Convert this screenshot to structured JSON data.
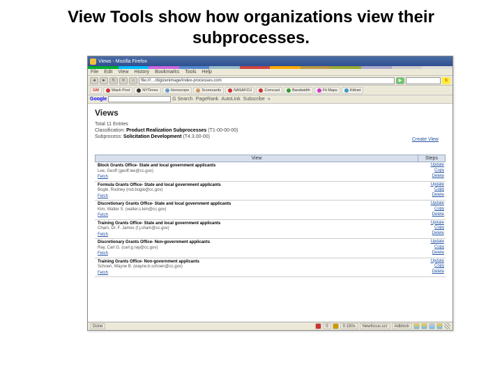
{
  "slide_title": "View Tools show how organizations view their subprocesses.",
  "window_title": "Views - Mozilla Firefox",
  "menu": [
    "File",
    "Edit",
    "View",
    "History",
    "Bookmarks",
    "Tools",
    "Help"
  ],
  "nav": {
    "address": "file:///…/digizenimage/index-processes.com"
  },
  "bookmarks": [
    {
      "label": "Wash Post",
      "color": "#c33"
    },
    {
      "label": "NYTimes",
      "color": "#333"
    },
    {
      "label": "Horoscope",
      "color": "#69c"
    },
    {
      "label": "Scorecards",
      "color": "#c96"
    },
    {
      "label": "NASAFCU",
      "color": "#c33"
    },
    {
      "label": "Comcast",
      "color": "#c33"
    },
    {
      "label": "Bandwidth",
      "color": "#393"
    },
    {
      "label": "Fit Maps",
      "color": "#c3c"
    },
    {
      "label": "Kittnet",
      "color": "#39c"
    }
  ],
  "google_bar": {
    "logo": "Google",
    "items": [
      "G Search",
      "PageRank",
      "AutoLink",
      "Subscribe",
      "»"
    ]
  },
  "views": {
    "heading": "Views",
    "total": "Total 11 Entries",
    "classification_label": "Classification:",
    "classification_value": "Product Realization Subprocesses",
    "classification_code": "(T1-00-00-00)",
    "subprocess_label": "Subprocess:",
    "subprocess_value": "Solicitation Development",
    "subprocess_code": "(T4.3.00-00)",
    "create": "Create View",
    "col_view": "View",
    "col_steps": "Steps",
    "rows": [
      {
        "title": "Block Grants Office- State and local government applicants",
        "sub": "Lee, Geoff (geoff.lee@cc.gov)"
      },
      {
        "title": "Formula Grants Office- State and local government applicants",
        "sub": "Bogle, Rodney (rod.bogle@cc.gov)"
      },
      {
        "title": "Discretionary Grants Office- State and local government applicants",
        "sub": "Kim, Walter S. (walter.s.kim@cc.gov)"
      },
      {
        "title": "Training Grants Office- State and local government applicants",
        "sub": "Cham, Dr. F. James (f.j.cham@cc.gov)"
      },
      {
        "title": "Discretionary Grants Office- Non-government applicants",
        "sub": "Ray, Carl G. (carl.g.ray@cc.gov)"
      },
      {
        "title": "Training Grants Office- Non-government applicants",
        "sub": "Schoen, Wayne B. (wayne.b.schoen@cc.gov)"
      }
    ],
    "fetch": "Fetch",
    "actions": [
      "Update",
      "Copy",
      "Delete"
    ]
  },
  "status": {
    "done": "Done",
    "q": "0",
    "ad": "0.150s",
    "scr": "Newfocus.scr",
    "adb": "Adblock"
  },
  "stripe": [
    "#0a3",
    "#0bf",
    "#c6d",
    "#58c",
    "#9bc",
    "#c44",
    "#fa0",
    "#b94",
    "#9a3",
    "#aac",
    "#ccc",
    "#ddd"
  ]
}
